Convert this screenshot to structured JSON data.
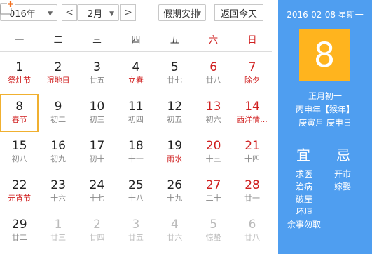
{
  "toolbar": {
    "year": "016年",
    "month": "2月",
    "holiday": "假期安排",
    "today_button": "返回今天",
    "prev": "<",
    "next": ">"
  },
  "weekdays": [
    "一",
    "二",
    "三",
    "四",
    "五",
    "六",
    "日"
  ],
  "weeks": [
    [
      {
        "n": "1",
        "l": "祭灶节",
        "fest": true
      },
      {
        "n": "2",
        "l": "湿地日",
        "fest": true
      },
      {
        "n": "3",
        "l": "廿五"
      },
      {
        "n": "4",
        "l": "立春",
        "fest": true
      },
      {
        "n": "5",
        "l": "廿七"
      },
      {
        "n": "6",
        "l": "廿八",
        "red": true
      },
      {
        "n": "7",
        "l": "除夕",
        "red": true,
        "fest": true
      }
    ],
    [
      {
        "n": "8",
        "l": "春节",
        "fest": true,
        "today": true
      },
      {
        "n": "9",
        "l": "初二"
      },
      {
        "n": "10",
        "l": "初三"
      },
      {
        "n": "11",
        "l": "初四"
      },
      {
        "n": "12",
        "l": "初五"
      },
      {
        "n": "13",
        "l": "初六",
        "red": true
      },
      {
        "n": "14",
        "l": "西洋情...",
        "red": true,
        "fest": true
      }
    ],
    [
      {
        "n": "15",
        "l": "初八"
      },
      {
        "n": "16",
        "l": "初九"
      },
      {
        "n": "17",
        "l": "初十"
      },
      {
        "n": "18",
        "l": "十一"
      },
      {
        "n": "19",
        "l": "雨水",
        "fest": true
      },
      {
        "n": "20",
        "l": "十三",
        "red": true
      },
      {
        "n": "21",
        "l": "十四",
        "red": true
      }
    ],
    [
      {
        "n": "22",
        "l": "元宵节",
        "fest": true
      },
      {
        "n": "23",
        "l": "十六"
      },
      {
        "n": "24",
        "l": "十七"
      },
      {
        "n": "25",
        "l": "十八"
      },
      {
        "n": "26",
        "l": "十九"
      },
      {
        "n": "27",
        "l": "二十",
        "red": true
      },
      {
        "n": "28",
        "l": "廿一",
        "red": true
      }
    ],
    [
      {
        "n": "29",
        "l": "廿二"
      },
      {
        "n": "1",
        "l": "廿三",
        "dim": true
      },
      {
        "n": "2",
        "l": "廿四",
        "dim": true
      },
      {
        "n": "3",
        "l": "廿五",
        "dim": true
      },
      {
        "n": "4",
        "l": "廿六",
        "dim": true
      },
      {
        "n": "5",
        "l": "惊蛰",
        "dim": true
      },
      {
        "n": "6",
        "l": "廿八",
        "dim": true
      }
    ]
  ],
  "panel": {
    "date_line": "2016-02-08 星期一",
    "big_day": "8",
    "lunar": "正月初一",
    "year_gz": "丙申年【猴年】",
    "month_day_gz": "庚寅月 庚申日",
    "yi_label": "宜",
    "ji_label": "忌",
    "yi_items": [
      "求医",
      "治病",
      "破屋",
      "坏垣",
      "余事勿取"
    ],
    "ji_items": [
      "开市",
      "嫁娶"
    ]
  },
  "colors": {
    "panel_bg": "#4f9ef0",
    "today_box": "#ffb41e",
    "holiday_red": "#d02020"
  }
}
